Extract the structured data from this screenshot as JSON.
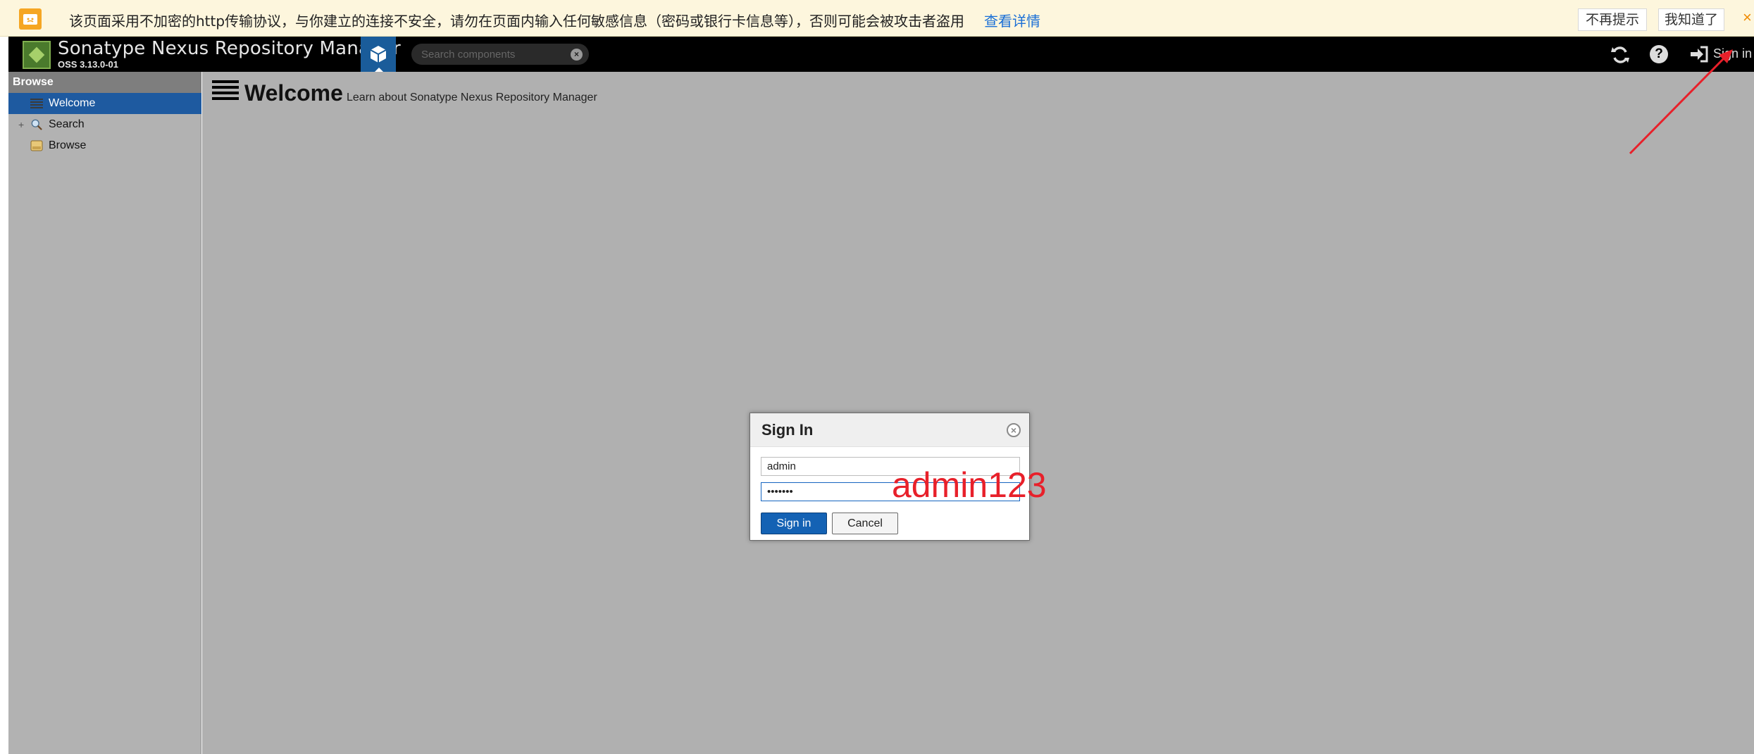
{
  "browser_warning": {
    "message": "该页面采用不加密的http传输协议，与你建立的连接不安全，请勿在页面内输入任何敏感信息（密码或银行卡信息等），否则可能会被攻击者盗用",
    "link": "查看详情",
    "dont_remind": "不再提示",
    "got_it": "我知道了",
    "close": "×"
  },
  "header": {
    "app_name": "Sonatype Nexus Repository Manager",
    "version": "OSS 3.13.0-01",
    "search_placeholder": "Search components",
    "search_clear": "×",
    "refresh_icon": "refresh-icon",
    "help_icon": "help-icon",
    "help_glyph": "?",
    "signin_label": "Sign in"
  },
  "sidebar": {
    "title": "Browse",
    "items": [
      {
        "label": "Welcome",
        "icon": "list-icon",
        "active": true
      },
      {
        "label": "Search",
        "icon": "magnifier-icon",
        "expander": "+"
      },
      {
        "label": "Browse",
        "icon": "database-icon"
      }
    ]
  },
  "main": {
    "title": "Welcome",
    "subtitle": "Learn about Sonatype Nexus Repository Manager"
  },
  "dialog": {
    "title": "Sign In",
    "username_value": "admin",
    "password_value": "•••••••",
    "signin_button": "Sign in",
    "cancel_button": "Cancel",
    "close": "×"
  },
  "annotation": {
    "text": "admin123",
    "color": "#e8202a"
  },
  "colors": {
    "header_bg": "#000000",
    "accent": "#1462b4",
    "content_bg": "#b0b0b0",
    "warning_bg": "#fdf6dd"
  }
}
